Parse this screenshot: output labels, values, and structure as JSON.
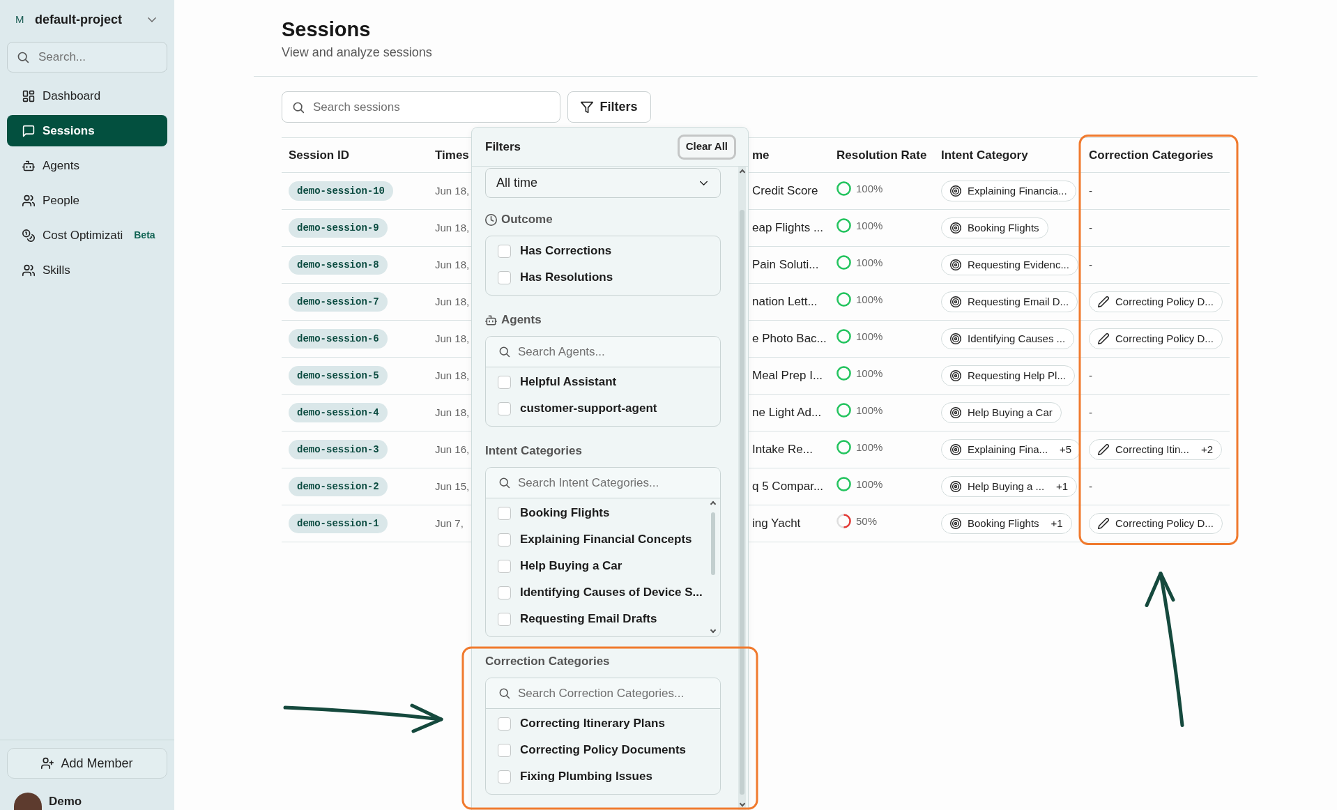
{
  "sidebar": {
    "project": {
      "initial": "M",
      "name": "default-project"
    },
    "search": {
      "placeholder": "Search..."
    },
    "items": [
      {
        "label": "Dashboard",
        "selected": false
      },
      {
        "label": "Sessions",
        "selected": true
      },
      {
        "label": "Agents",
        "selected": false
      },
      {
        "label": "People",
        "selected": false
      },
      {
        "label": "Cost Optimizati",
        "badge": "Beta",
        "selected": false
      },
      {
        "label": "Skills",
        "selected": false
      }
    ],
    "add_member_button": "Add Member",
    "user": {
      "name": "Demo"
    }
  },
  "header": {
    "title": "Sessions",
    "subtitle": "View and analyze sessions"
  },
  "toolbar": {
    "search": {
      "placeholder": "Search sessions"
    },
    "filters_button": "Filters"
  },
  "table": {
    "columns": [
      {
        "label": "Session ID",
        "highlighted": false
      },
      {
        "label": "Times",
        "highlighted": false
      },
      {
        "label": "me",
        "highlighted": false
      },
      {
        "label": "Resolution Rate",
        "highlighted": false
      },
      {
        "label": "Intent Category",
        "highlighted": false
      },
      {
        "label": "Correction Categories",
        "highlighted": true
      }
    ],
    "rows": [
      {
        "session_id": "demo-session-10",
        "column_2": "Jun 18,",
        "column_3": "Credit Score",
        "resolution_rate": {
          "level": 1,
          "reading": "100%"
        },
        "intent_category": {
          "label": "Explaining Financia..."
        },
        "correction_categories": {
          "kind": "empty",
          "text": "-"
        }
      },
      {
        "session_id": "demo-session-9",
        "column_2": "Jun 18,",
        "column_3": "eap Flights ...",
        "resolution_rate": {
          "level": 1,
          "reading": "100%"
        },
        "intent_category": {
          "label": "Booking Flights"
        },
        "correction_categories": {
          "kind": "empty",
          "text": "-"
        }
      },
      {
        "session_id": "demo-session-8",
        "column_2": "Jun 18,",
        "column_3": "Pain Soluti...",
        "resolution_rate": {
          "level": 1,
          "reading": "100%"
        },
        "intent_category": {
          "label": "Requesting Evidenc..."
        },
        "correction_categories": {
          "kind": "empty",
          "text": "-"
        }
      },
      {
        "session_id": "demo-session-7",
        "column_2": "Jun 18,",
        "column_3": "nation Lett...",
        "resolution_rate": {
          "level": 1,
          "reading": "100%"
        },
        "intent_category": {
          "label": "Requesting Email D..."
        },
        "correction_categories": {
          "kind": "tag",
          "text": "Correcting Policy D..."
        }
      },
      {
        "session_id": "demo-session-6",
        "column_2": "Jun 18,",
        "column_3": "e Photo Bac...",
        "resolution_rate": {
          "level": 1,
          "reading": "100%"
        },
        "intent_category": {
          "label": "Identifying Causes ..."
        },
        "correction_categories": {
          "kind": "tag",
          "text": "Correcting Policy D..."
        }
      },
      {
        "session_id": "demo-session-5",
        "column_2": "Jun 18,",
        "column_3": "Meal Prep I...",
        "resolution_rate": {
          "level": 1,
          "reading": "100%"
        },
        "intent_category": {
          "label": "Requesting Help Pl..."
        },
        "correction_categories": {
          "kind": "empty",
          "text": "-"
        }
      },
      {
        "session_id": "demo-session-4",
        "column_2": "Jun 18,",
        "column_3": "ne Light Ad...",
        "resolution_rate": {
          "level": 1,
          "reading": "100%"
        },
        "intent_category": {
          "label": "Help Buying a Car"
        },
        "correction_categories": {
          "kind": "empty",
          "text": "-"
        }
      },
      {
        "session_id": "demo-session-3",
        "column_2": "Jun 16,",
        "column_3": "Intake Re...",
        "resolution_rate": {
          "level": 1,
          "reading": "100%"
        },
        "intent_category": {
          "label": "Explaining Fina...",
          "more": "+5"
        },
        "correction_categories": {
          "kind": "tag",
          "text": "Correcting Itin...",
          "more": "+2"
        }
      },
      {
        "session_id": "demo-session-2",
        "column_2": "Jun 15,",
        "column_3": "q 5 Compar...",
        "resolution_rate": {
          "level": 1,
          "reading": "100%"
        },
        "intent_category": {
          "label": "Help Buying a ...",
          "more": "+1"
        },
        "correction_categories": {
          "kind": "empty",
          "text": "-"
        }
      },
      {
        "session_id": "demo-session-1",
        "column_2": "Jun 7,",
        "column_3": "ing Yacht",
        "resolution_rate": {
          "level": 0.5,
          "reading": "50%"
        },
        "intent_category": {
          "label": "Booking Flights",
          "more": "+1"
        },
        "correction_categories": {
          "kind": "tag",
          "text": "Correcting Policy D..."
        }
      }
    ]
  },
  "filter_panel": {
    "title": "Filters",
    "clear_button": "Clear All",
    "time_range": {
      "value": "All time"
    },
    "sections": [
      {
        "title": "Outcome",
        "kind": "checklist",
        "highlighted": false,
        "options": [
          {
            "label": "Has Corrections",
            "checked": false
          },
          {
            "label": "Has Resolutions",
            "checked": false
          }
        ]
      },
      {
        "title": "Agents",
        "kind": "search-checklist",
        "highlighted": false,
        "search": {
          "placeholder": "Search Agents..."
        },
        "options": [
          {
            "label": "Helpful Assistant",
            "checked": false
          },
          {
            "label": "customer-support-agent",
            "checked": false
          }
        ]
      },
      {
        "title": "Intent Categories",
        "kind": "scroll-checklist",
        "highlighted": false,
        "search": {
          "placeholder": "Search Intent Categories..."
        },
        "options": [
          {
            "label": "Booking Flights",
            "checked": false
          },
          {
            "label": "Explaining Financial Concepts",
            "checked": false
          },
          {
            "label": "Help Buying a Car",
            "checked": false
          },
          {
            "label": "Identifying Causes of Device S...",
            "checked": false
          },
          {
            "label": "Requesting Email Drafts",
            "checked": false
          }
        ]
      },
      {
        "title": "Correction Categories",
        "kind": "search-checklist",
        "highlighted": true,
        "search": {
          "placeholder": "Search Correction Categories..."
        },
        "options": [
          {
            "label": "Correcting Itinerary Plans",
            "checked": false
          },
          {
            "label": "Correcting Policy Documents",
            "checked": false
          },
          {
            "label": "Fixing Plumbing Issues",
            "checked": false
          }
        ]
      }
    ]
  }
}
